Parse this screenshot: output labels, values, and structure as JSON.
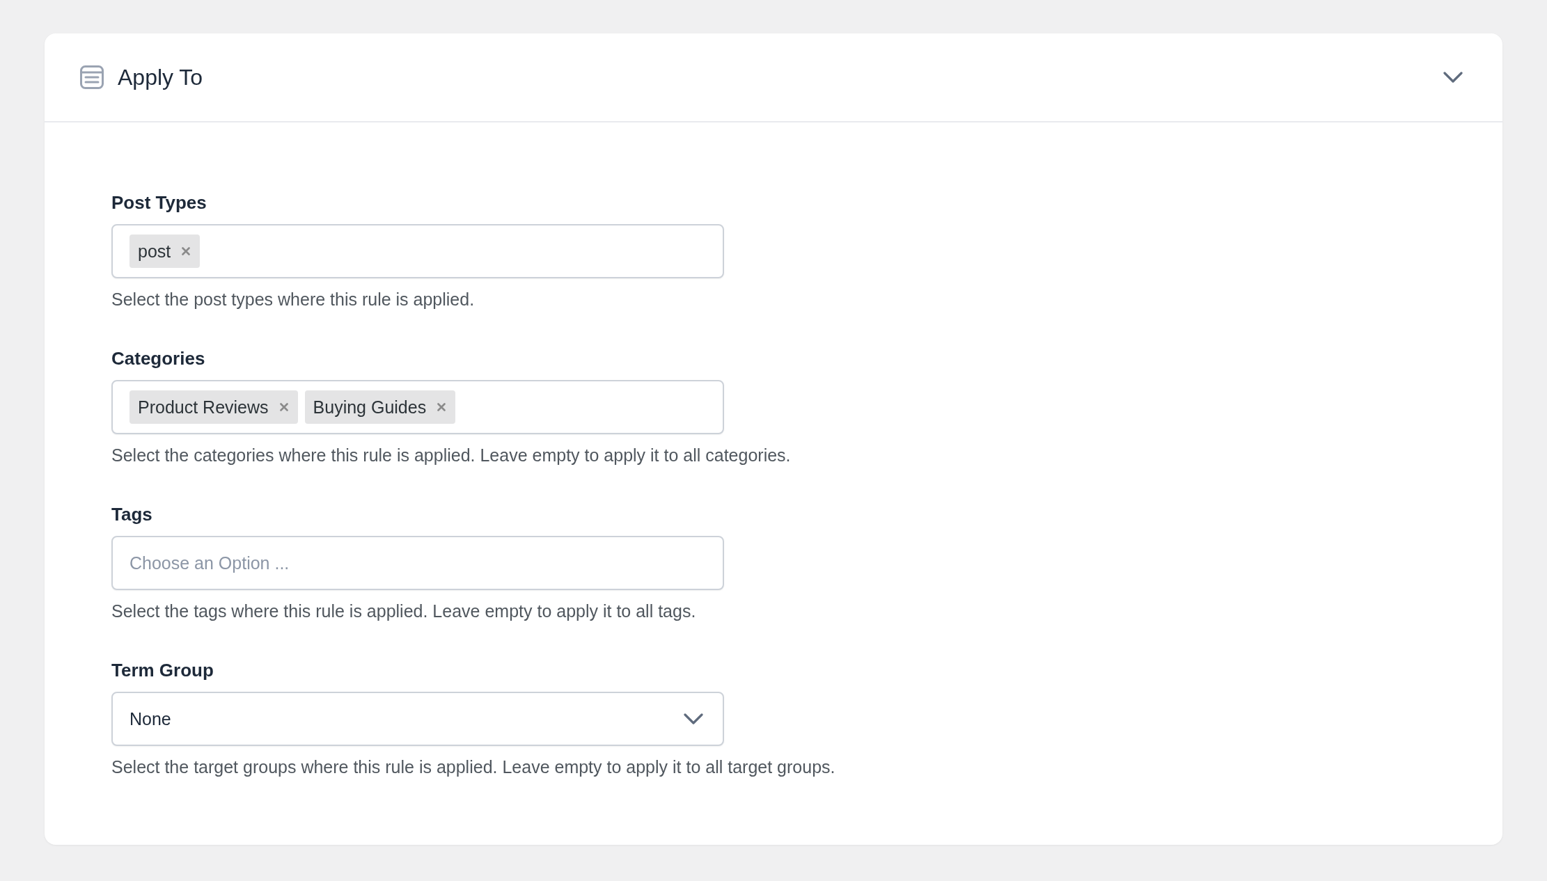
{
  "panel": {
    "title": "Apply To",
    "expanded": true
  },
  "fields": [
    {
      "kind": "multiselect",
      "label": "Post Types",
      "chips": [
        {
          "label": "post"
        }
      ],
      "help": "Select the post types where this rule is applied."
    },
    {
      "kind": "multiselect",
      "label": "Categories",
      "chips": [
        {
          "label": "Product Reviews"
        },
        {
          "label": "Buying Guides"
        }
      ],
      "help": "Select the categories where this rule is applied. Leave empty to apply it to all categories."
    },
    {
      "kind": "multiselect",
      "label": "Tags",
      "placeholder": "Choose an Option ...",
      "help": "Select the tags where this rule is applied. Leave empty to apply it to all tags."
    },
    {
      "kind": "select",
      "label": "Term Group",
      "value": "None",
      "help": "Select the target groups where this rule is applied. Leave empty to apply it to all target groups."
    }
  ]
}
